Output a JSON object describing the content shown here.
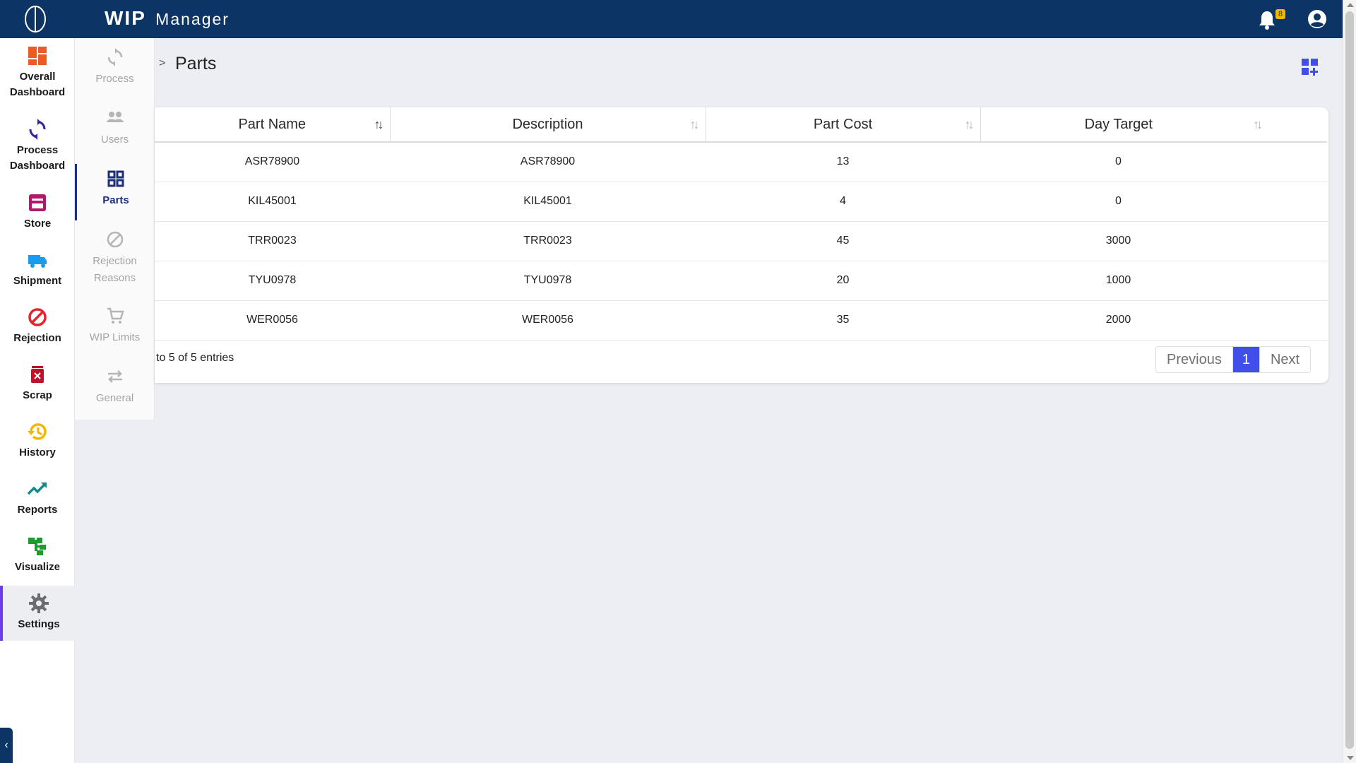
{
  "app": {
    "title": "WIP",
    "subtitle": "Manager",
    "notification_count": "8"
  },
  "sidebar": {
    "items": [
      {
        "label": "Overall\nDashboard",
        "icon": "dashboard-icon",
        "color": "#ee5a24"
      },
      {
        "label": "Process\nDashboard",
        "icon": "sync-icon",
        "color": "#3a1fa0"
      },
      {
        "label": "Store",
        "icon": "store-icon",
        "color": "#b5156b"
      },
      {
        "label": "Shipment",
        "icon": "truck-icon",
        "color": "#1b9bf0"
      },
      {
        "label": "Rejection",
        "icon": "block-icon",
        "color": "#e5242e"
      },
      {
        "label": "Scrap",
        "icon": "trash-icon",
        "color": "#c0122a"
      },
      {
        "label": "History",
        "icon": "history-icon",
        "color": "#f2b705"
      },
      {
        "label": "Reports",
        "icon": "trending-up-icon",
        "color": "#138a8a"
      },
      {
        "label": "Visualize",
        "icon": "tree-icon",
        "color": "#1e9a2e"
      },
      {
        "label": "Settings",
        "icon": "gear-icon",
        "color": "#6c6c6c"
      }
    ]
  },
  "submenu": {
    "items": [
      {
        "label": "Process",
        "icon": "sync-icon"
      },
      {
        "label": "Users",
        "icon": "users-icon"
      },
      {
        "label": "Parts",
        "icon": "grid-icon"
      },
      {
        "label": "Rejection\nReasons",
        "icon": "block-icon"
      },
      {
        "label": "WIP Limits",
        "icon": "cart-icon"
      },
      {
        "label": "General",
        "icon": "swap-icon"
      }
    ],
    "active": "Parts"
  },
  "breadcrumb": {
    "separator": ">",
    "title": "Parts"
  },
  "table": {
    "columns": [
      "Part Name",
      "Description",
      "Part Cost",
      "Day Target"
    ],
    "rows": [
      [
        "ASR78900",
        "ASR78900",
        "13",
        "0"
      ],
      [
        "KIL45001",
        "KIL45001",
        "4",
        "0"
      ],
      [
        "TRR0023",
        "TRR0023",
        "45",
        "3000"
      ],
      [
        "TYU0978",
        "TYU0978",
        "20",
        "1000"
      ],
      [
        "WER0056",
        "WER0056",
        "35",
        "2000"
      ]
    ],
    "info": "to 5 of 5 entries"
  },
  "pagination": {
    "previous": "Previous",
    "current": "1",
    "next": "Next"
  },
  "colors": {
    "topbar": "#0c3566",
    "accent": "#3f4fe8",
    "active_border": "#6a3de8"
  }
}
